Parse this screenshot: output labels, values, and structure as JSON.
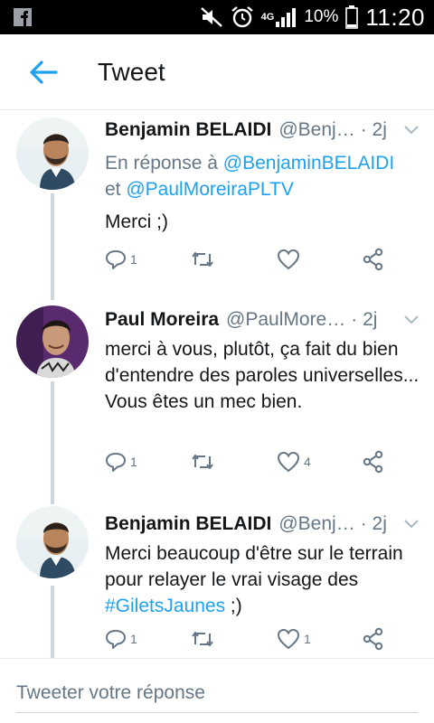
{
  "status_bar": {
    "network": "4G",
    "battery_percent": "10%",
    "time": "11:20"
  },
  "app_bar": {
    "title": "Tweet",
    "back_icon": "arrow-left-icon"
  },
  "colors": {
    "accent": "#1da1f2",
    "text": "#14171a",
    "secondary": "#657786",
    "thread_line": "#ccd6dd"
  },
  "tweets": [
    {
      "name": "Benjamin BELAIDI",
      "handle": "@Benj…",
      "time": "· 2j",
      "reply_prefix": "En réponse à ",
      "reply_mention_1": "@BenjaminBELAIDI",
      "reply_join": "et ",
      "reply_mention_2": "@PaulMoreiraPLTV",
      "text": "Merci ;)",
      "reply_count": "1",
      "retweet_count": "",
      "like_count": ""
    },
    {
      "name": "Paul Moreira",
      "handle": "@PaulMore…",
      "time": "· 2j",
      "text": "merci à vous, plutôt, ça fait du bien d'entendre des paroles universelles... Vous êtes un mec bien.",
      "reply_count": "1",
      "retweet_count": "",
      "like_count": "4"
    },
    {
      "name": "Benjamin BELAIDI",
      "handle": "@Benj…",
      "time": "· 2j",
      "text_before": "Merci beaucoup d'être sur le terrain pour relayer le vrai visage des ",
      "hashtag": "#GiletsJaunes",
      "text_after": " ;)",
      "reply_count": "1",
      "retweet_count": "",
      "like_count": "1"
    }
  ],
  "compose": {
    "placeholder": "Tweeter votre réponse"
  }
}
